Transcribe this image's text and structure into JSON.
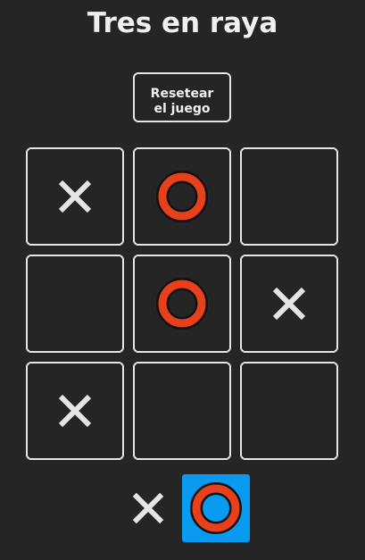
{
  "title": "Tres en raya",
  "reset_label": "Resetear el juego",
  "board": [
    "X",
    "O",
    "",
    "",
    "O",
    "X",
    "X",
    "",
    ""
  ],
  "turn": {
    "players": [
      "X",
      "O"
    ],
    "active": "O"
  },
  "colors": {
    "background": "#252525",
    "x_mark": "#e6e6e6",
    "o_fill": "#e8401c",
    "o_outline": "#111111",
    "turn_highlight": "#0a9af0",
    "cell_border": "#e6e6e6"
  },
  "icons": {
    "x": "cross-icon",
    "o": "ring-icon"
  }
}
